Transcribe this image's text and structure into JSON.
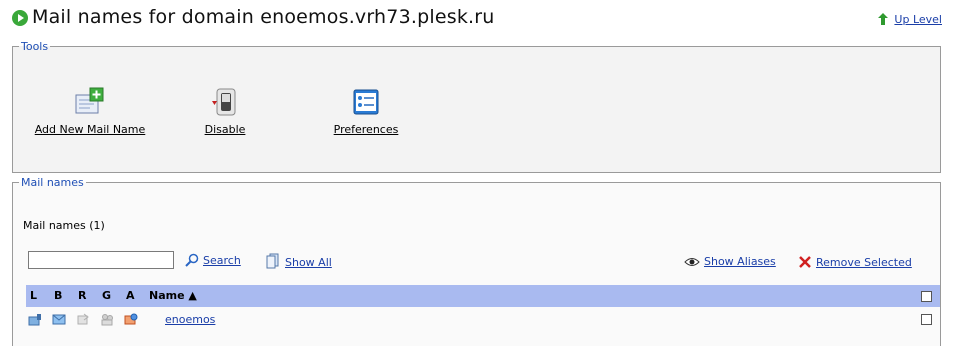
{
  "header": {
    "title": "Mail names for domain enoemos.vrh73.plesk.ru",
    "up_level": "Up Level"
  },
  "tools": {
    "legend": "Tools",
    "items": [
      {
        "label": "Add New Mail Name",
        "icon": "add-mail-icon"
      },
      {
        "label": "Disable",
        "icon": "switch-icon"
      },
      {
        "label": "Preferences",
        "icon": "preferences-icon"
      }
    ]
  },
  "mailnames": {
    "legend": "Mail names",
    "count_label": "Mail names (1)",
    "search": {
      "value": "",
      "button": "Search",
      "show_all": "Show All"
    },
    "show_aliases": "Show Aliases",
    "remove_selected": "Remove Selected",
    "columns": [
      "L",
      "B",
      "R",
      "G",
      "A",
      "Name ▲"
    ],
    "rows": [
      {
        "name": "enoemos"
      }
    ]
  }
}
